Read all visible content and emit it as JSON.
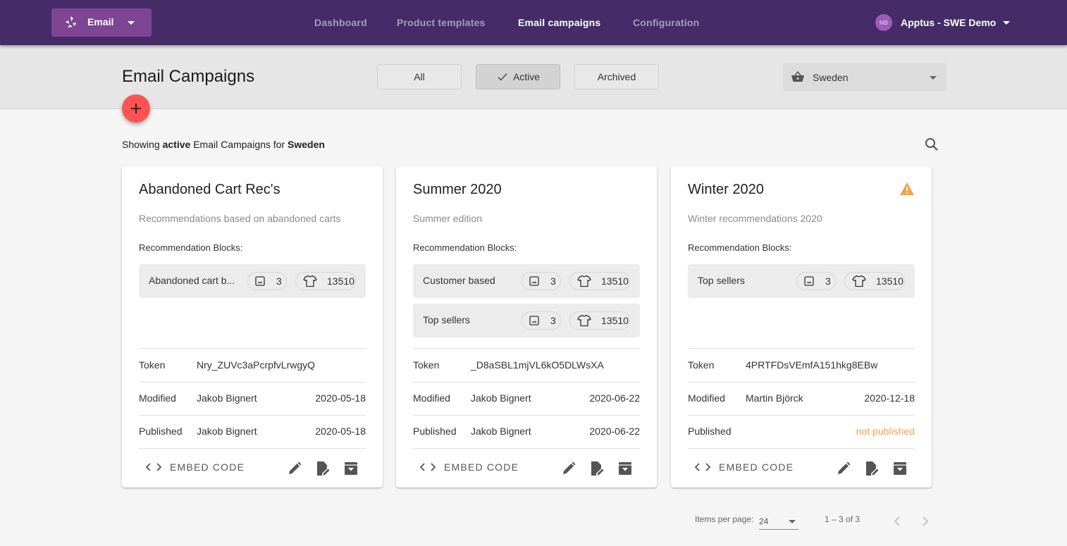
{
  "app": {
    "switcher_label": "Email",
    "nav": [
      {
        "label": "Dashboard",
        "active": false
      },
      {
        "label": "Product templates",
        "active": false
      },
      {
        "label": "Email campaigns",
        "active": true
      },
      {
        "label": "Configuration",
        "active": false
      }
    ],
    "account": {
      "initials": "MB",
      "name": "Apptus - SWE Demo"
    }
  },
  "header": {
    "title": "Email Campaigns",
    "filters": [
      {
        "label": "All",
        "active": false
      },
      {
        "label": "Active",
        "active": true
      },
      {
        "label": "Archived",
        "active": false
      }
    ],
    "store_select": {
      "value": "Sweden",
      "icon": "basket-icon"
    },
    "add_button_icon": "plus-icon"
  },
  "summary": {
    "prefix": "Showing",
    "status": "active",
    "middle": "Email Campaigns for",
    "store": "Sweden"
  },
  "cards": [
    {
      "title": "Abandoned Cart Rec's",
      "warning": false,
      "description": "Recommendations based on abandoned carts",
      "blocks_label": "Recommendation Blocks:",
      "blocks": [
        {
          "name": "Abandoned cart b...",
          "images": "3",
          "products": "13510"
        }
      ],
      "token_label": "Token",
      "token": "Nry_ZUVc3aPcrpfvLrwgyQ",
      "modified_label": "Modified",
      "modified_by": "Jakob Bignert",
      "modified_date": "2020-05-18",
      "published_label": "Published",
      "published_by": "Jakob Bignert",
      "published_date": "2020-05-18",
      "embed_label": "EMBED CODE"
    },
    {
      "title": "Summer 2020",
      "warning": false,
      "description": "Summer edition",
      "blocks_label": "Recommendation Blocks:",
      "blocks": [
        {
          "name": "Customer based",
          "images": "3",
          "products": "13510"
        },
        {
          "name": "Top sellers",
          "images": "3",
          "products": "13510"
        }
      ],
      "token_label": "Token",
      "token": "_D8aSBL1mjVL6kO5DLWsXA",
      "modified_label": "Modified",
      "modified_by": "Jakob Bignert",
      "modified_date": "2020-06-22",
      "published_label": "Published",
      "published_by": "Jakob Bignert",
      "published_date": "2020-06-22",
      "embed_label": "EMBED CODE"
    },
    {
      "title": "Winter 2020",
      "warning": true,
      "description": "Winter recommendations 2020",
      "blocks_label": "Recommendation Blocks:",
      "blocks": [
        {
          "name": "Top sellers",
          "images": "3",
          "products": "13510"
        }
      ],
      "token_label": "Token",
      "token": "4PRTFDsVEmfA151hkg8EBw",
      "modified_label": "Modified",
      "modified_by": "Martin Björck",
      "modified_date": "2020-12-18",
      "published_label": "Published",
      "published_by": "",
      "published_date": "not published",
      "embed_label": "EMBED CODE"
    }
  ],
  "paginator": {
    "items_per_page_label": "Items per page:",
    "items_per_page": "24",
    "range": "1 – 3 of 3"
  },
  "colors": {
    "topbar": "#452c68",
    "switcher": "#7e4594",
    "fab": "#ff5252",
    "warning": "#f5a04a"
  }
}
